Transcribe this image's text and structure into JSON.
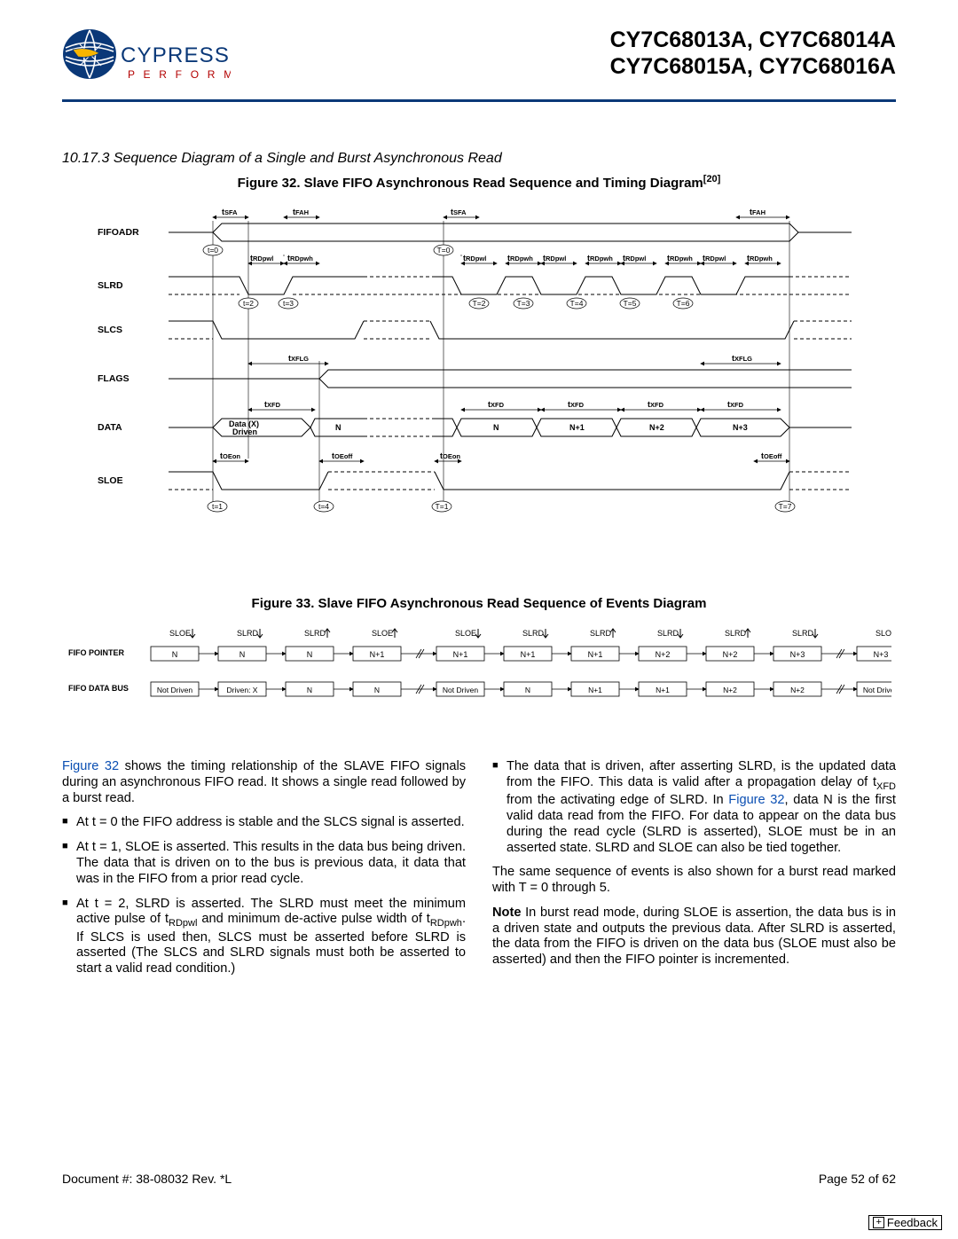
{
  "header": {
    "brand_top": "CYPRESS",
    "brand_bottom": "P E R F O R M",
    "title1": "CY7C68013A, CY7C68014A",
    "title2": "CY7C68015A, CY7C68016A"
  },
  "section_heading": "10.17.3  Sequence Diagram of a Single and Burst Asynchronous Read",
  "fig32_caption": "Figure 32.  Slave FIFO Asynchronous Read Sequence and Timing Diagram",
  "fig32_sup": "[20]",
  "fig33_caption": "Figure 33.  Slave FIFO Asynchronous Read Sequence of Events Diagram",
  "timing": {
    "signals": [
      "FIFOADR",
      "SLRD",
      "SLCS",
      "FLAGS",
      "DATA",
      "SLOE"
    ],
    "top_labels": {
      "tSFA": "tSFA",
      "tFAH": "tFAH",
      "tRDpwl": "tRDpwl",
      "tRDpwh": "tRDpwh",
      "tXFLG": "tXFLG",
      "tXFD": "tXFD",
      "tOEon": "tOEon",
      "tOEoff": "tOEoff"
    },
    "time_markers": [
      "t=0",
      "t=2",
      "t=3",
      "T=0",
      "T=2",
      "T=3",
      "T=4",
      "T=5",
      "T=6",
      "t=1",
      "t=4",
      "T=1",
      "T=7"
    ],
    "data_labels": [
      "Data (X) Driven",
      "N",
      "N",
      "N+1",
      "N+2",
      "N+3"
    ]
  },
  "events": {
    "rows": [
      "FIFO POINTER",
      "FIFO DATA BUS"
    ],
    "edge_labels": [
      "SLOE",
      "SLRD",
      "SLRD",
      "SLOE",
      "SLOE",
      "SLRD",
      "SLRD",
      "SLRD",
      "SLRD",
      "SLRD",
      "SLOE"
    ],
    "edge_dirs": [
      "down",
      "down",
      "up",
      "up",
      "down",
      "down",
      "up",
      "down",
      "up",
      "down",
      "up"
    ],
    "pointer": [
      "N",
      "N",
      "N",
      "N+1",
      "N+1",
      "N+1",
      "N+1",
      "N+2",
      "N+2",
      "N+3",
      "N+3"
    ],
    "databus": [
      "Not Driven",
      "Driven: X",
      "N",
      "N",
      "Not Driven",
      "N",
      "N+1",
      "N+1",
      "N+2",
      "N+2",
      "Not Driven"
    ]
  },
  "body": {
    "left": {
      "p1_a": "Figure 32",
      "p1_b": " shows the timing relationship of the SLAVE FIFO signals during an asynchronous FIFO read. It shows a single read followed by a burst read.",
      "b1": "At t = 0 the FIFO address is stable and the SLCS signal is asserted.",
      "b2": "At t = 1, SLOE is asserted. This results in the data bus being driven. The data that is driven on to the bus is previous data, it data that was in the FIFO from a prior read cycle.",
      "b3_a": "At t = 2, SLRD is asserted. The SLRD must meet the minimum active pulse of t",
      "b3_sub1": "RDpwl",
      "b3_b": " and minimum de-active pulse width of t",
      "b3_sub2": "RDpwh",
      "b3_c": ". If SLCS is used then, SLCS must be asserted before SLRD is asserted (The SLCS and SLRD signals must both be asserted to start a valid read condition.)"
    },
    "right": {
      "b1_a": "The data that is driven, after asserting SLRD, is the updated data from the FIFO. This data is valid after a propagation delay of t",
      "b1_sub": "XFD",
      "b1_b": " from the activating edge of SLRD. In ",
      "b1_link": "Figure 32",
      "b1_c": ", data N is the first valid data read from the FIFO. For data to appear on the data bus during the read cycle (SLRD is asserted), SLOE must be in an asserted state. SLRD and SLOE can also be tied together.",
      "p2": "The same sequence of events is also shown for a burst read marked with T = 0 through 5.",
      "p3_a": "Note",
      "p3_b": " In burst read mode, during SLOE is assertion, the data bus is in a driven state and outputs the previous data. After SLRD is asserted, the data from the FIFO is driven on the data bus (SLOE must also be asserted) and then the FIFO pointer is incremented."
    }
  },
  "footer": {
    "doc": "Document #: 38-08032 Rev. *L",
    "page": "Page 52 of 62",
    "feedback": "Feedback"
  }
}
